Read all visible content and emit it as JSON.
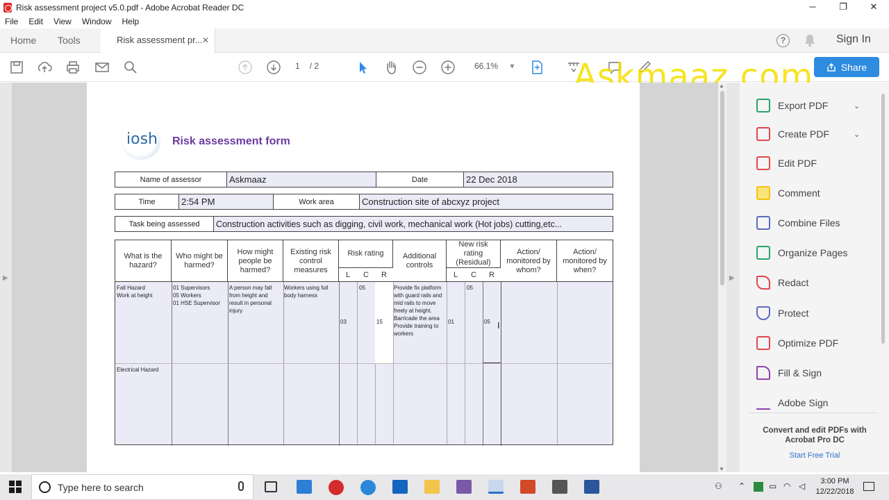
{
  "window": {
    "title": "Risk assessment project v5.0.pdf - Adobe Acrobat Reader DC",
    "controls": [
      "─",
      "❐",
      "✕"
    ]
  },
  "menu": [
    "File",
    "Edit",
    "View",
    "Window",
    "Help"
  ],
  "tabs": {
    "home": "Home",
    "tools": "Tools",
    "document": "Risk assessment pr...",
    "close": "✕"
  },
  "header": {
    "help": "?",
    "sign_in": "Sign In"
  },
  "toolbar": {
    "page_current": "1",
    "page_total": "/ 2",
    "zoom": "66.1%",
    "zoom_caret": "▾",
    "share": "Share"
  },
  "watermark": "Askmaaz.com",
  "document": {
    "logo_text": "iosh",
    "title": "Risk assessment form",
    "fields": {
      "assessor_label": "Name of assessor",
      "assessor_value": "Askmaaz",
      "date_label": "Date",
      "date_value": "22 Dec 2018",
      "time_label": "Time",
      "time_value": "2:54 PM",
      "work_area_label": "Work area",
      "work_area_value": "Construction site of abcxyz project",
      "task_label": "Task being assessed",
      "task_value": "Construction activities such as digging, civil work, mechanical work (Hot jobs) cutting,etc..."
    },
    "table": {
      "headers": {
        "hazard": "What is the hazard?",
        "who": "Who might be harmed?",
        "how": "How might people be harmed?",
        "existing": "Existing risk control measures",
        "risk_rating": "Risk rating",
        "additional": "Additional controls",
        "new_rating": "New risk rating (Residual)",
        "action_whom": "Action/ monitored by whom?",
        "action_when": "Action/ monitored by when?",
        "l": "L",
        "c": "C",
        "r": "R"
      },
      "rows": [
        {
          "hazard_1": "Fall Hazard",
          "hazard_2": "Work at height",
          "who_1": "01 Supervisors",
          "who_2": "05 Workers",
          "who_3": "01 HSE Supervisor",
          "how": "A person may fall from height and result in personal injury",
          "existing": "Workers using full body harness",
          "l": "03",
          "c": "05",
          "r": "15",
          "additional_1": "Provide fix platform with guard rails and mid rails to move freely at height.",
          "additional_2": "Barricade the area",
          "additional_3": "Provide training to workers",
          "new_l": "01",
          "new_c": "05",
          "new_r": "05"
        },
        {
          "hazard_1": "Electrical Hazard"
        }
      ]
    }
  },
  "tools_pane": {
    "items": [
      {
        "label": "Export PDF",
        "color": "#2aa36b",
        "chevron": "⌄"
      },
      {
        "label": "Create PDF",
        "color": "#e0474c",
        "chevron": "⌄"
      },
      {
        "label": "Edit PDF",
        "color": "#e0474c"
      },
      {
        "label": "Comment",
        "color": "#f4c20d"
      },
      {
        "label": "Combine Files",
        "color": "#5c6bc0"
      },
      {
        "label": "Organize Pages",
        "color": "#2aa36b"
      },
      {
        "label": "Redact",
        "color": "#e0474c"
      },
      {
        "label": "Protect",
        "color": "#5c6bc0"
      },
      {
        "label": "Optimize PDF",
        "color": "#e0474c"
      },
      {
        "label": "Fill & Sign",
        "color": "#8e44ad"
      },
      {
        "label": "Adobe Sign",
        "color": "#8e44ad"
      }
    ],
    "promo": "Convert and edit PDFs with Acrobat Pro DC",
    "trial": "Start Free Trial"
  },
  "taskbar": {
    "search_placeholder": "Type here to search",
    "time": "3:00 PM",
    "date": "12/22/2018"
  }
}
